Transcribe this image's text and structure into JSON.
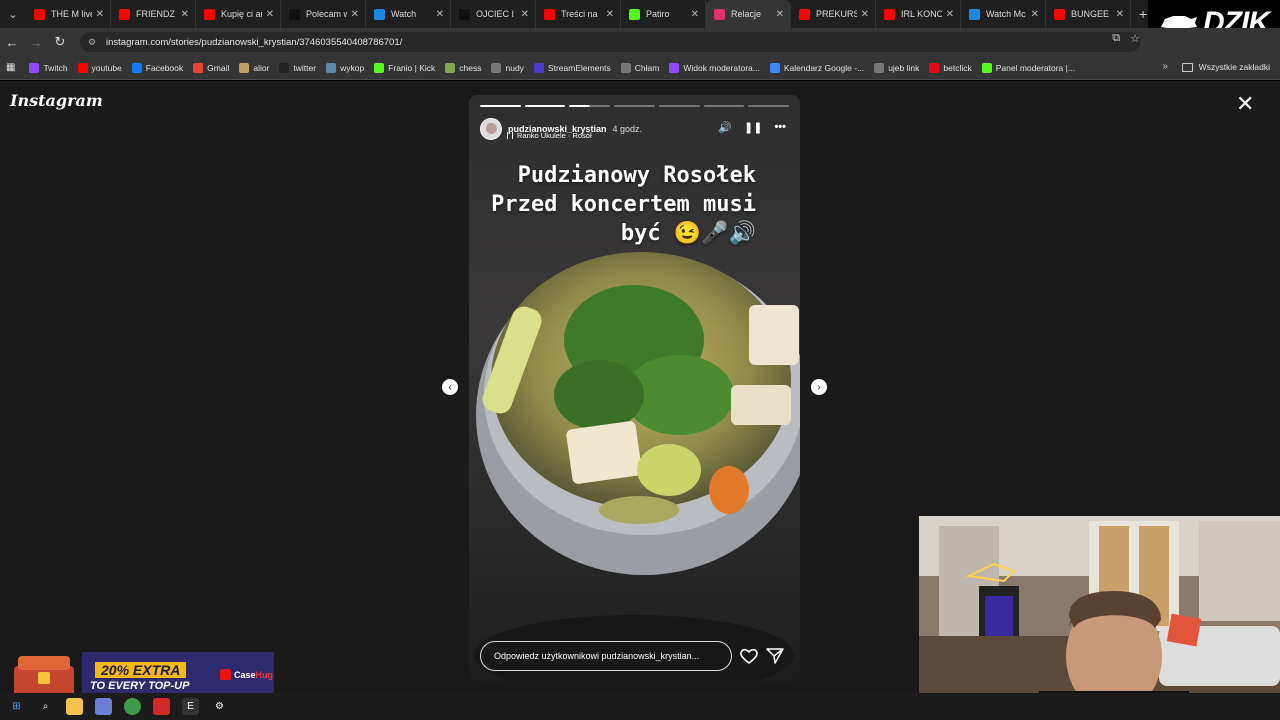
{
  "browser": {
    "tabs": [
      {
        "label": "THE M live",
        "icon": "youtube-icon",
        "color": "#ff0000"
      },
      {
        "label": "FRIENDZ",
        "icon": "youtube-icon",
        "color": "#ff0000"
      },
      {
        "label": "Kupię ci ar",
        "icon": "youtube-icon",
        "color": "#ff0000"
      },
      {
        "label": "Polecam w",
        "icon": "tiktok-icon",
        "color": "#111111"
      },
      {
        "label": "Watch",
        "icon": "watch-icon",
        "color": "#1e88e5"
      },
      {
        "label": "OJCIEC I SY",
        "icon": "tiktok-icon",
        "color": "#111111"
      },
      {
        "label": "Treści na",
        "icon": "youtube-icon",
        "color": "#ff0000"
      },
      {
        "label": "Patiro",
        "icon": "kick-icon",
        "color": "#53fc18"
      },
      {
        "label": "Relacje",
        "icon": "instagram-icon",
        "color": "#e1306c"
      },
      {
        "label": "PREKURSC",
        "icon": "youtube-icon",
        "color": "#ff0000"
      },
      {
        "label": "IRL KONCI",
        "icon": "youtube-icon",
        "color": "#ff0000"
      },
      {
        "label": "Watch Mc",
        "icon": "watch-icon",
        "color": "#1e88e5"
      },
      {
        "label": "BUNGEE",
        "icon": "youtube-icon",
        "color": "#ff0000"
      }
    ],
    "active_tab": 8,
    "new_tab": "+",
    "url": "instagram.com/stories/pudzianowski_krystian/3746035540408786701/",
    "bookmarks": [
      {
        "label": "Twitch",
        "color": "#9146ff"
      },
      {
        "label": "youtube",
        "color": "#ff0000"
      },
      {
        "label": "Facebook",
        "color": "#1877f2"
      },
      {
        "label": "Gmail",
        "color": "#ea4335"
      },
      {
        "label": "alior",
        "color": "#c0a060"
      },
      {
        "label": "twitter",
        "color": "#222222"
      },
      {
        "label": "wykop",
        "color": "#5d8aa8"
      },
      {
        "label": "Franio | Kick",
        "color": "#53fc18"
      },
      {
        "label": "chess",
        "color": "#7fa650"
      },
      {
        "label": "nudy",
        "color": "#777777"
      },
      {
        "label": "StreamElements",
        "color": "#4b3ad8"
      },
      {
        "label": "Chłam",
        "color": "#777777"
      },
      {
        "label": "Widok moderatora...",
        "color": "#9146ff"
      },
      {
        "label": "Kalendarz Google -...",
        "color": "#4285f4"
      },
      {
        "label": "ujeb link",
        "color": "#777777"
      },
      {
        "label": "betclick",
        "color": "#e50914"
      },
      {
        "label": "Panel moderatora |...",
        "color": "#53fc18"
      }
    ],
    "all_bookmarks": "Wszystkie zakładki"
  },
  "branding": {
    "dzik_logo": "DZIK"
  },
  "instagram": {
    "logo": "Instagram",
    "close": "✕",
    "story": {
      "username": "pudzianowski_krystian",
      "time": "4 godz.",
      "music": "Ranko Ukulele · Rosół",
      "overlay_text": "Pudzianowy Rosołek\nPrzed koncertem musi\nbyć 😉🎤🔊",
      "segments_total": 7,
      "segments_done": 2,
      "segment_current_progress": 0.5,
      "reply_placeholder": "Odpowiedz użytkownikowi pudzianowski_krystian..."
    },
    "prev_arrow": "‹",
    "next_arrow": "›"
  },
  "ad": {
    "line1": "20% EXTRA",
    "line2": "TO EVERY TOP-UP",
    "brand_a": "Case",
    "brand_b": "Hug"
  }
}
